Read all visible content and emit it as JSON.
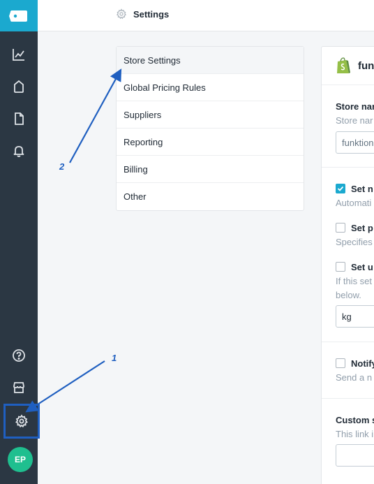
{
  "header": {
    "title": "Settings",
    "icon": "gear-icon"
  },
  "rail": {
    "logo_icon": "tag-logo-icon",
    "items": [
      {
        "icon": "analytics-chart-icon"
      },
      {
        "icon": "bag-icon"
      },
      {
        "icon": "document-icon"
      },
      {
        "icon": "bell-icon"
      },
      {
        "icon": "help-icon"
      },
      {
        "icon": "store-icon"
      },
      {
        "icon": "gear-icon",
        "selected": true
      }
    ],
    "avatar_initials": "EP"
  },
  "settings_menu": {
    "items": [
      {
        "label": "Store Settings",
        "active": true
      },
      {
        "label": "Global Pricing Rules"
      },
      {
        "label": "Suppliers"
      },
      {
        "label": "Reporting"
      },
      {
        "label": "Billing"
      },
      {
        "label": "Other"
      }
    ]
  },
  "panel": {
    "title": "fun",
    "store_name": {
      "label": "Store nar",
      "help": "Store nar",
      "value": "funktion"
    },
    "options": [
      {
        "label": "Set n",
        "checked": true,
        "help": "Automati"
      },
      {
        "label": "Set p",
        "checked": false,
        "help": "Specifies"
      },
      {
        "label": "Set u",
        "checked": false,
        "help": "If this set",
        "help2": "below.",
        "value": "kg"
      }
    ],
    "notify": {
      "label": "Notify",
      "checked": false,
      "help": "Send a n"
    },
    "custom": {
      "label": "Custom s",
      "help": "This link i"
    }
  },
  "annotations": {
    "one": "1",
    "two": "2",
    "color": "#1f5fc0"
  },
  "colors": {
    "rail": "#2b3743",
    "brand": "#1ba9cf",
    "avatar": "#1fbf8f"
  }
}
